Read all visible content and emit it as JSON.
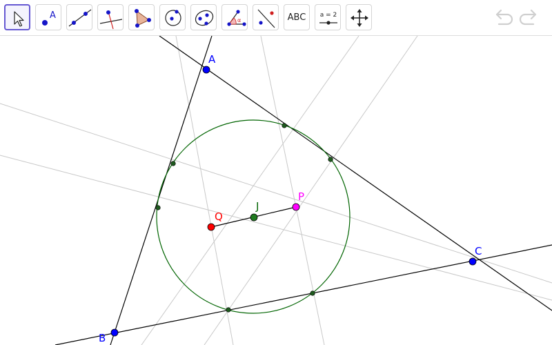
{
  "toolbar": {
    "tools": [
      {
        "name": "move-tool",
        "active": true
      },
      {
        "name": "point-tool",
        "label": "A"
      },
      {
        "name": "line-tool"
      },
      {
        "name": "perpendicular-line-tool"
      },
      {
        "name": "polygon-tool"
      },
      {
        "name": "circle-center-point-tool"
      },
      {
        "name": "conic-tool"
      },
      {
        "name": "angle-tool",
        "label": "α"
      },
      {
        "name": "reflect-tool"
      },
      {
        "name": "text-tool",
        "label": "ABC"
      },
      {
        "name": "slider-tool",
        "label": "a = 2"
      },
      {
        "name": "move-graphics-view-tool"
      }
    ],
    "undo_label": "undo",
    "redo_label": "redo"
  },
  "construction": {
    "points": [
      {
        "name": "A",
        "color": "#0000ff"
      },
      {
        "name": "B",
        "color": "#0000ff"
      },
      {
        "name": "C",
        "color": "#0000ff"
      },
      {
        "name": "Q",
        "color": "#ff0000"
      },
      {
        "name": "J",
        "color": "#006400"
      },
      {
        "name": "P",
        "color": "#ff00ff"
      }
    ],
    "circle_color": "#006400",
    "triangle_color": "#000000",
    "helper_line_color": "#c8c8c8"
  }
}
